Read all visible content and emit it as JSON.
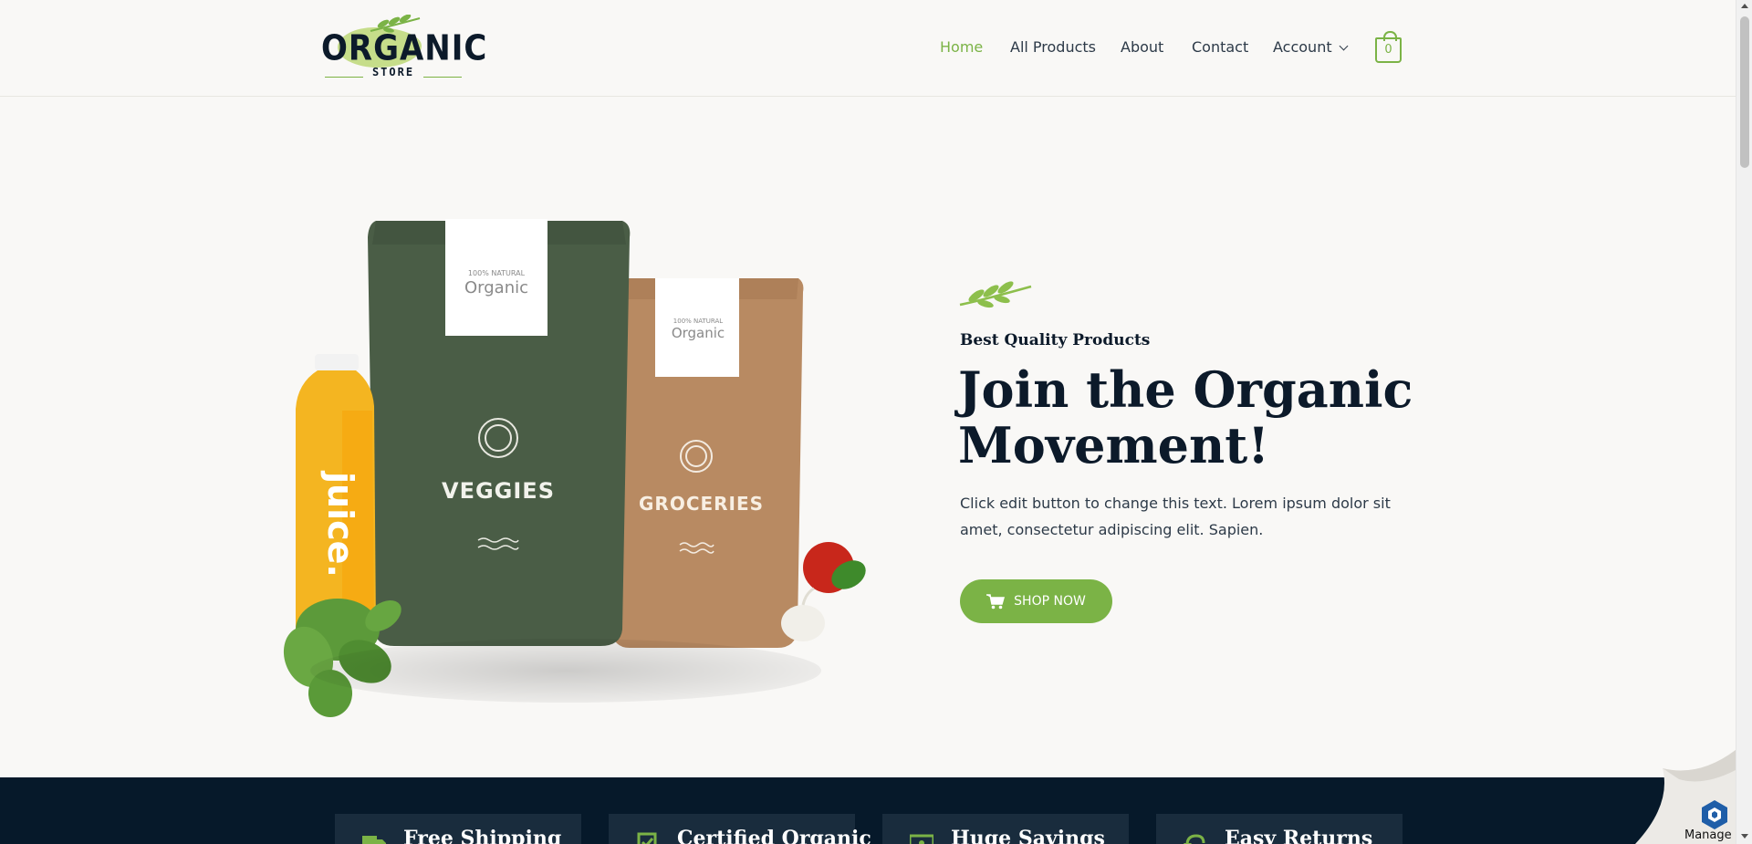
{
  "brand": {
    "logo_main": "ORGANIC",
    "logo_sub": "STORE",
    "accent_color": "#7bb346",
    "dark_color": "#0c1a2a"
  },
  "nav": {
    "items": [
      {
        "label": "Home",
        "active": true
      },
      {
        "label": "All Products",
        "active": false
      },
      {
        "label": "About",
        "active": false
      },
      {
        "label": "Contact",
        "active": false
      },
      {
        "label": "Account",
        "active": false,
        "dropdown": true
      }
    ],
    "cart_count": "0"
  },
  "hero": {
    "eyebrow": "Best Quality Products",
    "headline_line1": "Join the Organic",
    "headline_line2": "Movement!",
    "description": "Click edit button to change this text. Lorem ipsum dolor sit amet, consectetur adipiscing elit. Sapien.",
    "cta_label": "SHOP NOW",
    "image_labels": {
      "bag_green_label": "Organic",
      "bag_green_seal": "100% NATURAL",
      "bag_green_name": "VEGGIES",
      "bag_kraft_label": "Organic",
      "bag_kraft_seal": "100% NATURAL",
      "bag_kraft_name": "GROCERIES",
      "bottle_word": "juice."
    }
  },
  "features": [
    {
      "title": "Free Shipping",
      "icon": "truck-icon"
    },
    {
      "title": "Certified Organic",
      "icon": "certificate-icon"
    },
    {
      "title": "Huge Savings",
      "icon": "money-icon"
    },
    {
      "title": "Easy Returns",
      "icon": "return-icon"
    }
  ],
  "widget": {
    "manage_label": "Manage"
  }
}
